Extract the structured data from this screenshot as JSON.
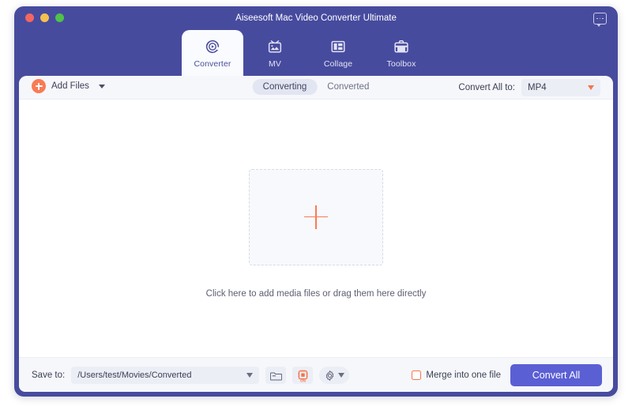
{
  "window": {
    "title": "Aiseesoft Mac Video Converter Ultimate",
    "traffic_lights": [
      "close",
      "minimize",
      "maximize"
    ],
    "feedback_icon": "chat-bubble-icon",
    "frame_color": "#474b9e"
  },
  "tabs": [
    {
      "label": "Converter",
      "icon": "convert-circle-play-icon",
      "active": true
    },
    {
      "label": "MV",
      "icon": "tv-photo-icon",
      "active": false
    },
    {
      "label": "Collage",
      "icon": "collage-grid-icon",
      "active": false
    },
    {
      "label": "Toolbox",
      "icon": "toolbox-briefcase-icon",
      "active": false
    }
  ],
  "toolbar": {
    "add_files_label": "Add Files",
    "add_files_icon": "plus-circle-icon",
    "add_files_caret_icon": "caret-down-icon",
    "segments": [
      {
        "label": "Converting",
        "active": true
      },
      {
        "label": "Converted",
        "active": false
      }
    ],
    "convert_all_to_label": "Convert All to:",
    "format_value": "MP4",
    "format_caret_icon": "caret-down-icon"
  },
  "main": {
    "dropzone_icon": "plus-icon",
    "hint": "Click here to add media files or drag them here directly"
  },
  "bottom": {
    "save_to_label": "Save to:",
    "save_path": "/Users/test/Movies/Converted",
    "path_caret_icon": "caret-down-icon",
    "folder_button_icon": "folder-icon",
    "hardware_accel_icon": "cpu-chip-icon",
    "hardware_accel_state": "ON",
    "settings_icon": "gear-icon",
    "settings_caret_icon": "caret-down-icon",
    "merge_label": "Merge into one file",
    "merge_checked": false,
    "convert_all_label": "Convert All"
  },
  "colors": {
    "brand_purple": "#474b9e",
    "accent_button": "#5b5fd4",
    "accent_orange": "#f97b55",
    "panel_bg": "#f6f7fb"
  }
}
